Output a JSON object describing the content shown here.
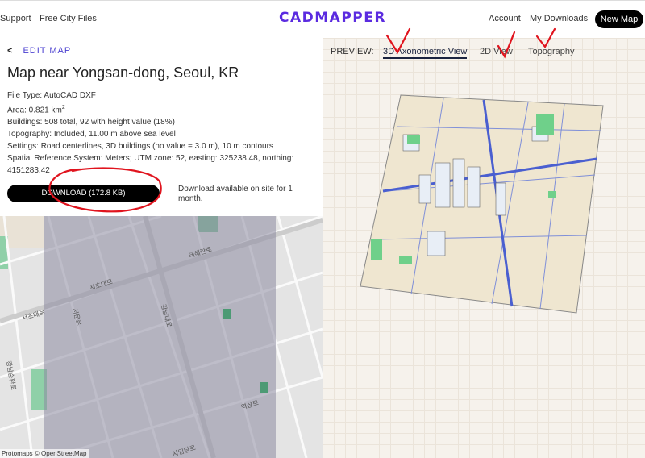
{
  "nav": {
    "support": "Support",
    "free_city_files": "Free City Files",
    "logo": "CADMAPPER",
    "account": "Account",
    "my_downloads": "My Downloads",
    "new_map": "New Map"
  },
  "info": {
    "edit_map": "EDIT MAP",
    "title": "Map near Yongsan-dong, Seoul, KR",
    "file_type": "File Type: AutoCAD DXF",
    "area": "Area: 0.821 km",
    "area_sup": "2",
    "buildings": "Buildings: 508 total, 92 with height value (18%)",
    "topography": "Topography: Included, 11.00 m above sea level",
    "settings": "Settings: Road centerlines, 3D buildings (no value = 3.0 m), 10 m contours",
    "srs": "Spatial Reference System: Meters; UTM zone: 52, easting: 325238.48, northing: 4151283.42",
    "download_button": "DOWNLOAD (172.8 KB)",
    "download_note": "Download available on site for 1 month."
  },
  "map": {
    "labels": [
      "테헤란로",
      "서초대로",
      "서초대로",
      "서운로",
      "강남대로",
      "역삼로",
      "사임당로",
      "강남순환로"
    ],
    "attribution": "Protomaps © OpenStreetMap"
  },
  "preview": {
    "label": "PREVIEW:",
    "tabs": [
      {
        "label": "3D Axonometric View",
        "active": true
      },
      {
        "label": "2D View",
        "active": false
      },
      {
        "label": "Topography",
        "active": false
      }
    ]
  },
  "colors": {
    "brand": "#5b2be0",
    "annotation": "#e0141e"
  }
}
